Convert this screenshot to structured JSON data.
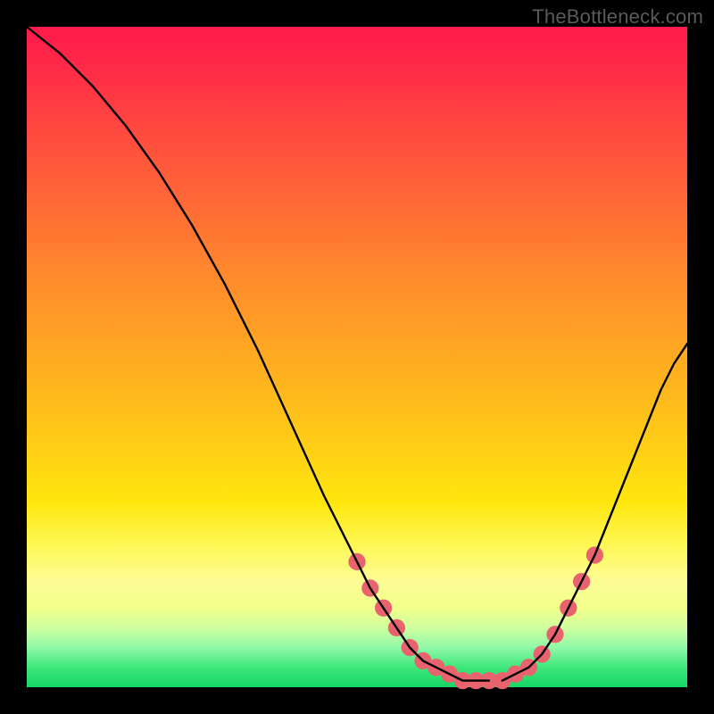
{
  "watermark": "TheBottleneck.com",
  "chart_data": {
    "type": "line",
    "title": "",
    "xlabel": "",
    "ylabel": "",
    "xlim": [
      0,
      100
    ],
    "ylim": [
      0,
      100
    ],
    "grid": false,
    "legend": false,
    "series": [
      {
        "name": "left-curve",
        "x": [
          0,
          5,
          10,
          15,
          20,
          25,
          30,
          35,
          40,
          45,
          50,
          52,
          54,
          56,
          58,
          60,
          62,
          64,
          66,
          68,
          70
        ],
        "y": [
          100,
          96,
          91,
          85,
          78,
          70,
          61,
          51,
          40,
          29,
          19,
          15,
          12,
          9,
          6,
          4,
          3,
          2,
          1,
          1,
          1
        ]
      },
      {
        "name": "right-curve",
        "x": [
          72,
          74,
          76,
          78,
          80,
          82,
          84,
          86,
          88,
          90,
          92,
          94,
          96,
          98,
          100
        ],
        "y": [
          1,
          2,
          3,
          5,
          8,
          12,
          16,
          20,
          25,
          30,
          35,
          40,
          45,
          49,
          52
        ]
      }
    ],
    "markers": {
      "name": "highlight-points",
      "color": "#e9636f",
      "radius_pct": 1.3,
      "x": [
        50,
        52,
        54,
        56,
        58,
        60,
        62,
        64,
        66,
        68,
        70,
        72,
        74,
        76,
        78,
        80,
        82,
        84,
        86
      ],
      "y": [
        19,
        15,
        12,
        9,
        6,
        4,
        3,
        2,
        1,
        1,
        1,
        1,
        2,
        3,
        5,
        8,
        12,
        16,
        20
      ]
    }
  }
}
